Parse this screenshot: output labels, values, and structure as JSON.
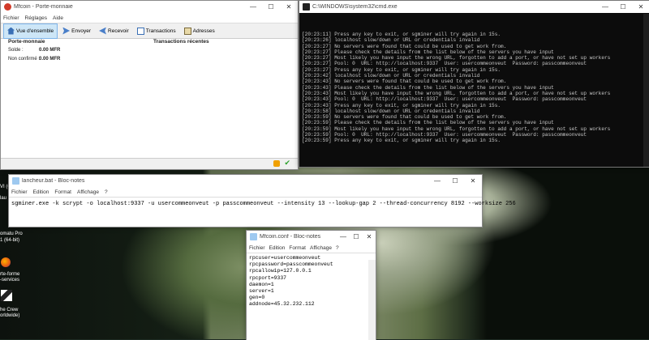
{
  "desktop": {
    "labels": [
      "VI (64 bi",
      "lau",
      "omatu Pro",
      "1 (64-bit)",
      "rte-forme",
      "-services",
      "he Crew",
      "orldwide)"
    ]
  },
  "mfcoin": {
    "title": "Mfcoin - Porte-monnaie",
    "menu": [
      "Fichier",
      "Réglages",
      "Aide"
    ],
    "toolbar": [
      {
        "label": "Vue d'ensemble",
        "icon": "home-icon"
      },
      {
        "label": "Envoyer",
        "icon": "send-icon"
      },
      {
        "label": "Recevoir",
        "icon": "receive-icon"
      },
      {
        "label": "Transactions",
        "icon": "transactions-icon"
      },
      {
        "label": "Adresses",
        "icon": "address-book-icon"
      }
    ],
    "wallet_heading": "Porte-monnaie",
    "transactions_heading": "Transactions récentes",
    "balance_label": "Solde :",
    "balance_value": "0.00 MFR",
    "unconfirmed_label": "Non confirmé :",
    "unconfirmed_value": "0.00 MFR"
  },
  "cmd": {
    "title": "C:\\WINDOWS\\system32\\cmd.exe",
    "lines": [
      "[20:23:11] Press any key to exit, or sgminer will try again in 15s.",
      "[20:23:26] localhost slow/down or URL or credentials invalid",
      "[20:23:27] No servers were found that could be used to get work from.",
      "[20:23:27] Please check the details from the list below of the servers you have input",
      "[20:23:27] Most likely you have input the wrong URL, forgotten to add a port, or have not set up workers",
      "[20:23:27] Pool: 0  URL: http://localhost:9337  User: usercommeonveut  Password: passcommeonveut",
      "[20:23:27] Press any key to exit, or sgminer will try again in 15s.",
      "[20:23:42] localhost slow/down or URL or credentials invalid",
      "[20:23:43] No servers were found that could be used to get work from.",
      "[20:23:43] Please check the details from the list below of the servers you have input",
      "[20:23:43] Most likely you have input the wrong URL, forgotten to add a port, or have not set up workers",
      "[20:23:43] Pool: 0  URL: http://localhost:9337  User: usercommeonveut  Password: passcommeonveut",
      "[20:23:43] Press any key to exit, or sgminer will try again in 15s.",
      "[20:23:58] localhost slow/down or URL or credentials invalid",
      "[20:23:59] No servers were found that could be used to get work from.",
      "[20:23:59] Please check the details from the list below of the servers you have input",
      "[20:23:59] Most likely you have input the wrong URL, forgotten to add a port, or have not set up workers",
      "[20:23:59] Pool: 0  URL: http://localhost:9337  User: usercommeonveut  Password: passcommeonveut",
      "[20:23:59] Press any key to exit, or sgminer will try again in 15s."
    ]
  },
  "notepad_bat": {
    "title": "lancheur.bat - Bloc-notes",
    "menu": [
      "Fichier",
      "Edition",
      "Format",
      "Affichage",
      "?"
    ],
    "text": "sgminer.exe -k scrypt -o localhost:9337 -u usercommeonveut -p passcommeonveut --intensity 13 --lookup-gap 2 --thread-concurrency 8192 --worksize 256"
  },
  "notepad_conf": {
    "title": "Mfcoin.conf - Bloc-notes",
    "menu": [
      "Fichier",
      "Edition",
      "Format",
      "Affichage",
      "?"
    ],
    "lines": [
      "rpcuser=usercommeonveut",
      "rpcpassword=passcommeonveut",
      "rpcallowip=127.0.0.1",
      "rpcport=9337",
      "daemon=1",
      "server=1",
      "gen=0",
      "addnode=45.32.232.112"
    ]
  }
}
